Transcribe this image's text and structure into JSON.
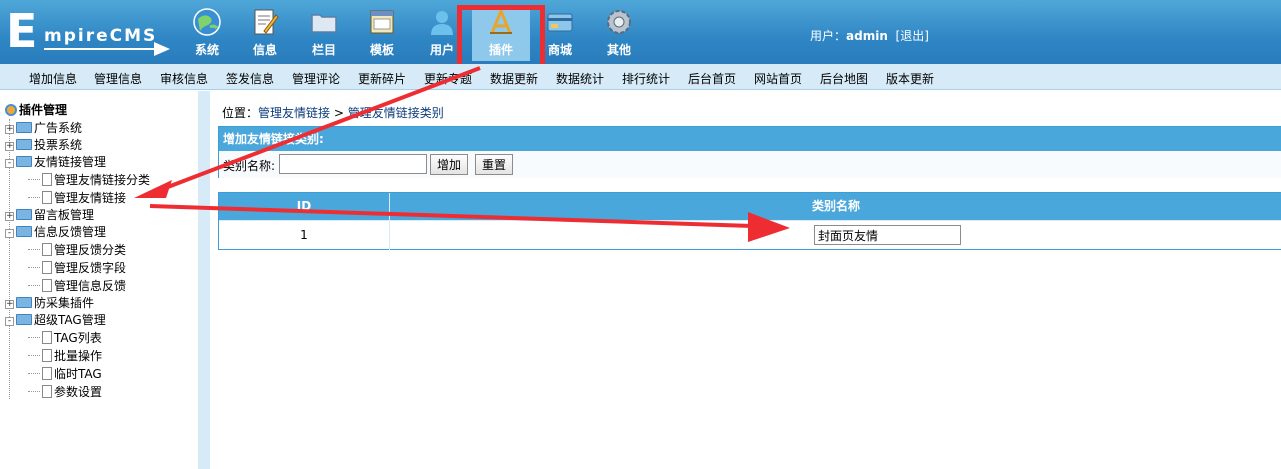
{
  "logo": {
    "first_letter": "E",
    "rest": "mpireCMS"
  },
  "nav": [
    {
      "label": "系统",
      "icon": "globe-icon"
    },
    {
      "label": "信息",
      "icon": "edit-icon"
    },
    {
      "label": "栏目",
      "icon": "folder-icon"
    },
    {
      "label": "模板",
      "icon": "template-icon"
    },
    {
      "label": "用户",
      "icon": "user-icon"
    },
    {
      "label": "插件",
      "icon": "plugin-icon",
      "active": true
    },
    {
      "label": "商城",
      "icon": "shop-icon"
    },
    {
      "label": "其他",
      "icon": "gear-icon"
    }
  ],
  "user": {
    "prefix": "用户：",
    "name": "admin",
    "logout": "[退出]"
  },
  "quick_menu": [
    "增加信息",
    "管理信息",
    "审核信息",
    "签发信息",
    "管理评论",
    "更新碎片",
    "更新专题",
    "数据更新",
    "数据统计",
    "排行统计",
    "后台首页",
    "网站首页",
    "后台地图",
    "版本更新"
  ],
  "sidebar": {
    "title": "插件管理",
    "items": [
      {
        "label": "广告系统",
        "type": "folder",
        "toggle": "+"
      },
      {
        "label": "投票系统",
        "type": "folder",
        "toggle": "+"
      },
      {
        "label": "友情链接管理",
        "type": "folder",
        "toggle": "-"
      },
      {
        "label": "管理友情链接分类",
        "type": "doc"
      },
      {
        "label": "管理友情链接",
        "type": "doc"
      },
      {
        "label": "留言板管理",
        "type": "folder",
        "toggle": "+"
      },
      {
        "label": "信息反馈管理",
        "type": "folder",
        "toggle": "-"
      },
      {
        "label": "管理反馈分类",
        "type": "doc"
      },
      {
        "label": "管理反馈字段",
        "type": "doc"
      },
      {
        "label": "管理信息反馈",
        "type": "doc"
      },
      {
        "label": "防采集插件",
        "type": "folder",
        "toggle": "+"
      },
      {
        "label": "超级TAG管理",
        "type": "folder",
        "toggle": "-"
      },
      {
        "label": "TAG列表",
        "type": "doc"
      },
      {
        "label": "批量操作",
        "type": "doc"
      },
      {
        "label": "临时TAG",
        "type": "doc"
      },
      {
        "label": "参数设置",
        "type": "doc"
      }
    ]
  },
  "breadcrumb": {
    "prefix": "位置：",
    "link1": "管理友情链接",
    "sep": " > ",
    "link2": "管理友情链接类别"
  },
  "add_form": {
    "header": "增加友情链接类别:",
    "label": "类别名称:",
    "input_value": "",
    "add_button": "增加",
    "reset_button": "重置"
  },
  "table": {
    "columns": [
      "ID",
      "类别名称"
    ],
    "rows": [
      {
        "id": "1",
        "name": "封面页友情"
      }
    ]
  },
  "colors": {
    "header_blue": "#2f86c4",
    "light_blue": "#d6ebf7",
    "table_header": "#4aa7dc",
    "annotation_red": "#ee2d33"
  }
}
